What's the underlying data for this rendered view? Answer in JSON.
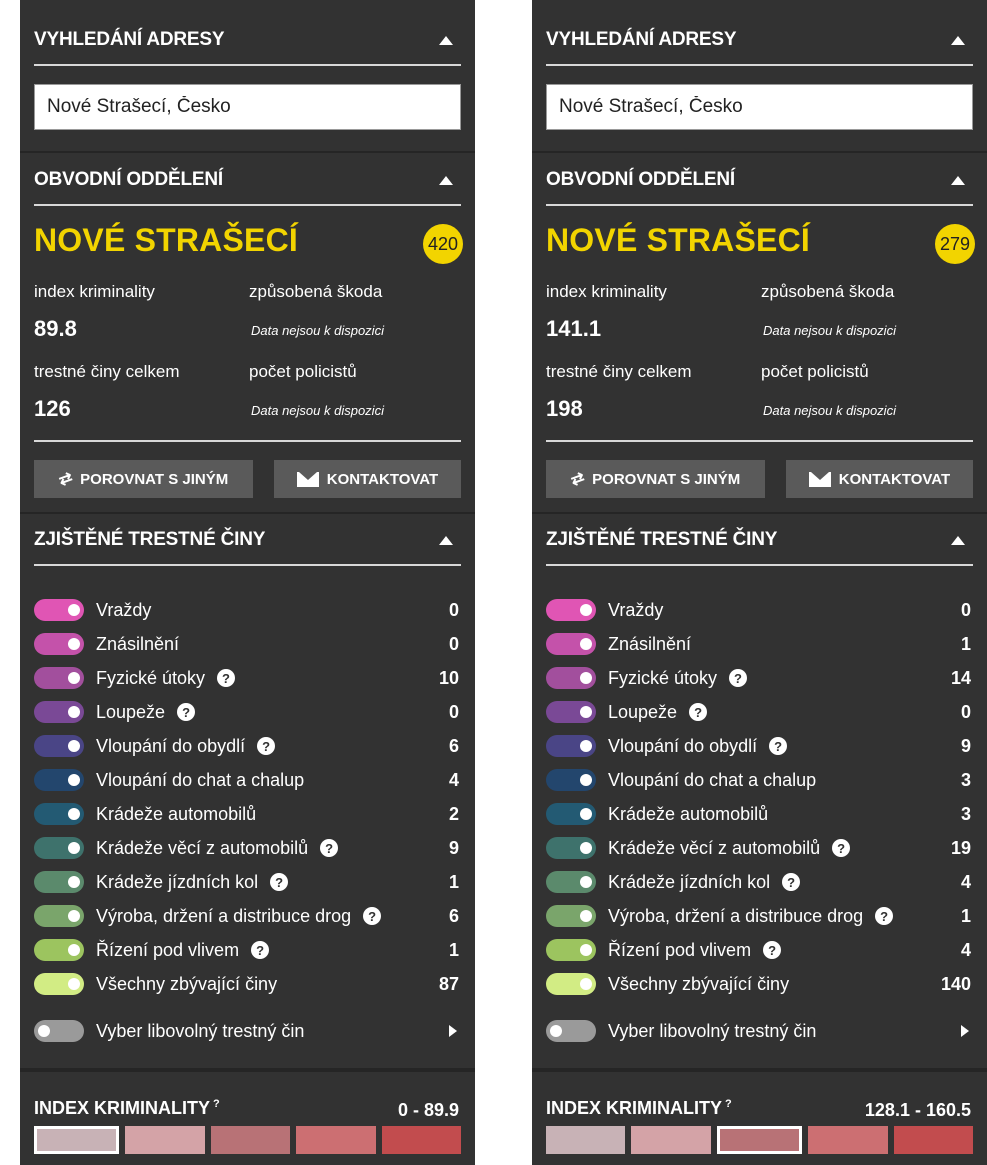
{
  "labels": {
    "address_header": "VYHLEDÁNÍ ADRESY",
    "district_header": "OBVODNÍ ODDĚLENÍ",
    "crime_index_label": "index kriminality",
    "damage_label": "způsobená škoda",
    "total_crimes_label": "trestné činy celkem",
    "police_count_label": "počet policistů",
    "not_available": "Data nejsou k dispozici",
    "compare_button": "POROVNAT S JINÝM",
    "contact_button": "KONTAKTOVAT",
    "crimes_header": "ZJIŠTĚNÉ TRESTNÉ ČINY",
    "pick_any_crime": "Vyber libovolný trestný čin",
    "index_header": "INDEX KRIMINALITY",
    "index_help": "?",
    "help_glyph": "?"
  },
  "crime_types": [
    {
      "label": "Vraždy",
      "color": "#e055b4",
      "help": false
    },
    {
      "label": "Znásilnění",
      "color": "#c452aa",
      "help": false
    },
    {
      "label": "Fyzické útoky",
      "color": "#a24f9d",
      "help": true
    },
    {
      "label": "Loupeže",
      "color": "#7a4996",
      "help": true
    },
    {
      "label": "Vloupání do obydlí",
      "color": "#4a4586",
      "help": true
    },
    {
      "label": "Vloupání do chat a chalup",
      "color": "#23466d",
      "help": false
    },
    {
      "label": "Krádeže automobilů",
      "color": "#235a73",
      "help": false
    },
    {
      "label": "Krádeže věcí z automobilů",
      "color": "#3e726c",
      "help": true
    },
    {
      "label": "Krádeže jízdních kol",
      "color": "#5b8a6c",
      "help": true
    },
    {
      "label": "Výroba, držení a distribuce drog",
      "color": "#7aa56b",
      "help": true
    },
    {
      "label": "Řízení pod vlivem",
      "color": "#9cc45f",
      "help": true
    },
    {
      "label": "Všechny zbývající činy",
      "color": "#d2ec84",
      "help": false
    }
  ],
  "toggle_off_color": "#9a9a9a",
  "scale_colors": [
    "#c8b2b6",
    "#d4a3a7",
    "#b87276",
    "#cc6f72",
    "#c24c4e"
  ],
  "panels": [
    {
      "address": "Nové Strašecí, Česko",
      "station": "NOVÉ STRAŠECÍ",
      "badge": "420",
      "crime_index": "89.8",
      "total_crimes": "126",
      "counts": [
        "0",
        "0",
        "10",
        "0",
        "6",
        "4",
        "2",
        "9",
        "1",
        "6",
        "1",
        "87"
      ],
      "index_range": "0 - 89.9",
      "selected_scale": 0
    },
    {
      "address": "Nové Strašecí, Česko",
      "station": "NOVÉ STRAŠECÍ",
      "badge": "279",
      "crime_index": "141.1",
      "total_crimes": "198",
      "counts": [
        "0",
        "1",
        "14",
        "0",
        "9",
        "3",
        "3",
        "19",
        "4",
        "1",
        "4",
        "140"
      ],
      "index_range": "128.1 - 160.5",
      "selected_scale": 2
    }
  ]
}
